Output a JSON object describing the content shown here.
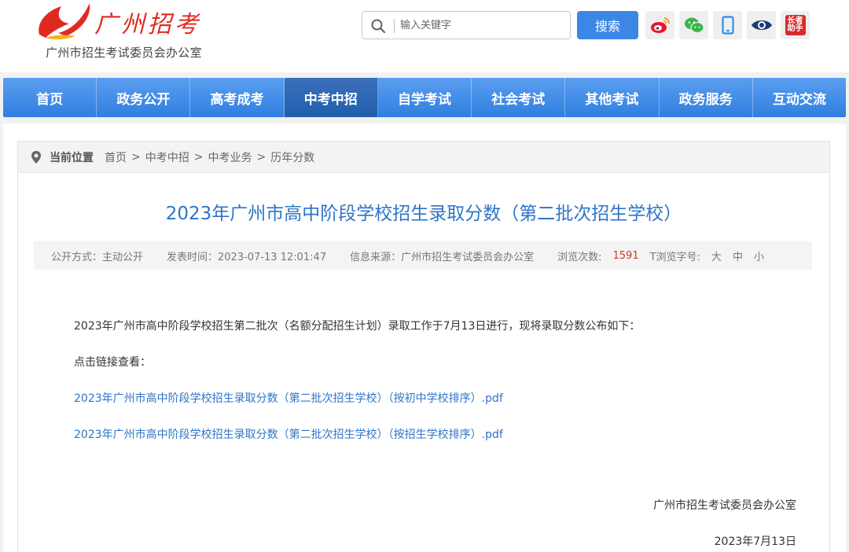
{
  "header": {
    "subtitle": "广州市招生考试委员会办公室",
    "logo_text": "广州招考",
    "search_placeholder": "输入关键字",
    "search_button": "搜索",
    "elder_label": "长者助手"
  },
  "nav": {
    "items": [
      "首页",
      "政务公开",
      "高考成考",
      "中考中招",
      "自学考试",
      "社会考试",
      "其他考试",
      "政务服务",
      "互动交流"
    ],
    "active_index": 3
  },
  "breadcrumb": {
    "label": "当前位置",
    "items": [
      "首页",
      "中考中招",
      "中考业务",
      "历年分数"
    ],
    "separator": ">"
  },
  "article": {
    "title": "2023年广州市高中阶段学校招生录取分数（第二批次招生学校）",
    "meta": {
      "disclosure": "公开方式：主动公开",
      "publish_time": "发表时间：2023-07-13 12:01:47",
      "source": "信息来源：广州市招生考试委员会办公室",
      "views_label": "浏览次数:",
      "views_count": "1591",
      "font_size_label": "T浏览字号:",
      "font_sizes": [
        "大",
        "中",
        "小"
      ]
    },
    "intro": "2023年广州市高中阶段学校招生第二批次（名额分配招生计划）录取工作于7月13日进行，现将录取分数公布如下：",
    "click_hint": "点击链接查看：",
    "links": [
      "2023年广州市高中阶段学校招生录取分数（第二批次招生学校）（按初中学校排序）.pdf",
      "2023年广州市高中阶段学校招生录取分数（第二批次招生学校）（按招生学校排序）.pdf"
    ],
    "signature": "广州市招生考试委员会办公室",
    "date": "2023年7月13日"
  },
  "colors": {
    "accent_blue": "#3c86e6",
    "title_blue": "#2f74c8",
    "views_red": "#d9332b",
    "logo_red": "#e02a20"
  }
}
